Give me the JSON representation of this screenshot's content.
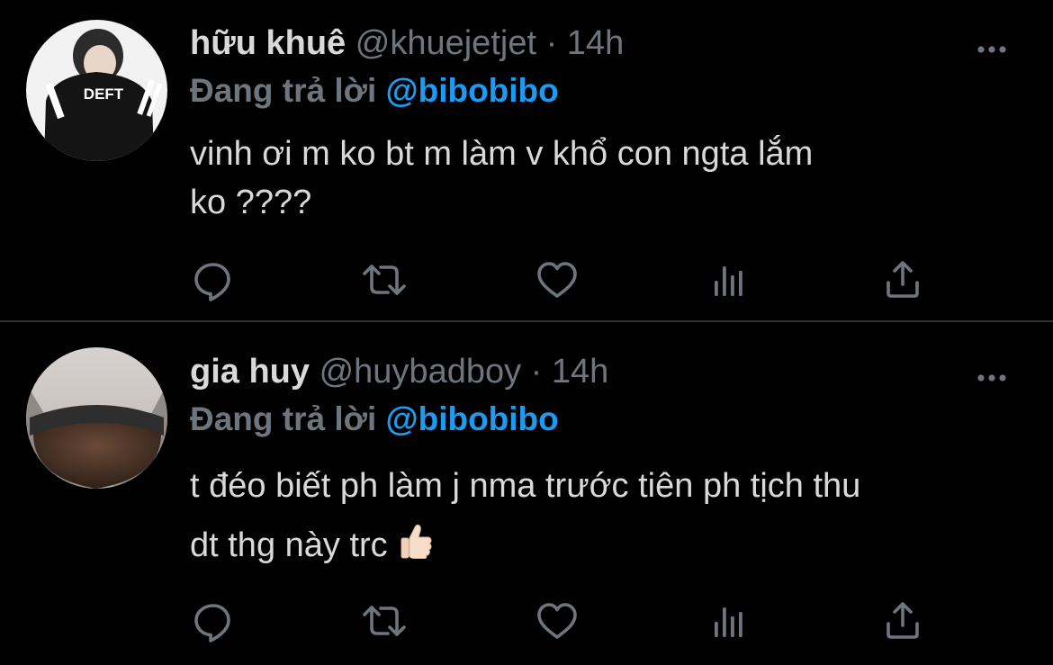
{
  "colors": {
    "background": "#000000",
    "text": "#d9d9d9",
    "muted": "#6e767d",
    "accent": "#1d9bf0",
    "divider": "#2f3336"
  },
  "tweets": [
    {
      "name": "hữu khuê",
      "handle": "@khuejetjet",
      "separator": "·",
      "time": "14h",
      "reply_prefix": "Đang trả lời",
      "reply_mention": "@bibobibo",
      "text_line1": "vinh ơi m ko bt m làm v khổ con ngta lắm",
      "text_line2": "ko ????",
      "avatar_text": "DEFT",
      "icons": [
        "more-icon",
        "reply-icon",
        "retweet-icon",
        "like-icon",
        "views-icon",
        "share-icon"
      ]
    },
    {
      "name": "gia huy",
      "handle": "@huybadboy",
      "separator": "·",
      "time": "14h",
      "reply_prefix": "Đang trả lời",
      "reply_mention": "@bibobibo",
      "text_line1": "t đéo biết ph làm j nma trước tiên ph tịch thu",
      "text_line2": "dt thg này trc",
      "emoji": "thumbs-up-emoji",
      "icons": [
        "more-icon",
        "reply-icon",
        "retweet-icon",
        "like-icon",
        "views-icon",
        "share-icon"
      ]
    }
  ]
}
